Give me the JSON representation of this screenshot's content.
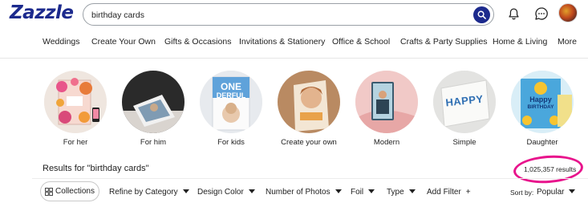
{
  "header": {
    "logo": "Zazzle",
    "search": {
      "value": "birthday cards",
      "placeholder": ""
    },
    "icons": [
      "bell-icon",
      "chat-icon",
      "avatar"
    ]
  },
  "nav": {
    "items": [
      "Weddings",
      "Create Your Own",
      "Gifts & Occasions",
      "Invitations & Stationery",
      "Office & School",
      "Crafts & Party Supplies",
      "Home & Living",
      "More"
    ]
  },
  "categories": [
    {
      "label": "For her"
    },
    {
      "label": "For him"
    },
    {
      "label": "For kids",
      "image_text": [
        "ONE",
        "DERFUL"
      ]
    },
    {
      "label": "Create your own"
    },
    {
      "label": "Modern"
    },
    {
      "label": "Simple",
      "image_text": [
        "HAPPY"
      ]
    },
    {
      "label": "Daughter",
      "image_text": [
        "Happy",
        "BIRTHDAY"
      ]
    }
  ],
  "results": {
    "title": "Results for \"birthday cards\"",
    "count": "1,025,357 results"
  },
  "filters": {
    "collections": "Collections",
    "items": [
      "Refine by Category",
      "Design Color",
      "Number of Photos",
      "Foil",
      "Type"
    ],
    "add_filter": "Add Filter",
    "sort_label": "Sort by:",
    "sort_value": "Popular"
  },
  "colors": {
    "brand": "#1c2a8d",
    "highlight_ring": "#e8148c"
  }
}
